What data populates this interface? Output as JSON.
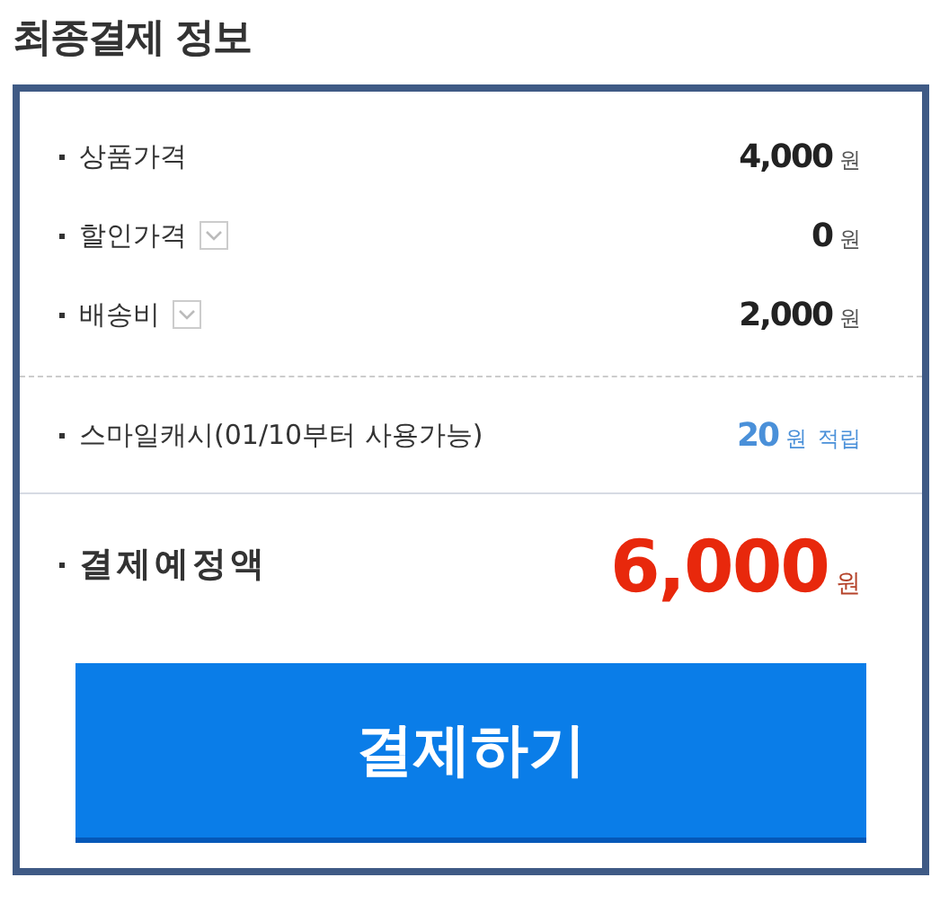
{
  "title": "최종결제 정보",
  "rows": [
    {
      "label": "상품가격",
      "toggle": false,
      "amount": "4,000",
      "unit": "원"
    },
    {
      "label": "할인가격",
      "toggle": true,
      "amount": "0",
      "unit": "원"
    },
    {
      "label": "배송비",
      "toggle": true,
      "amount": "2,000",
      "unit": "원"
    }
  ],
  "points": {
    "label": "스마일캐시(01/10부터 사용가능)",
    "amount": "20",
    "unit": "원",
    "note": "적립"
  },
  "total": {
    "label": "결제예정액",
    "amount": "6,000",
    "unit": "원"
  },
  "pay_button": "결제하기"
}
